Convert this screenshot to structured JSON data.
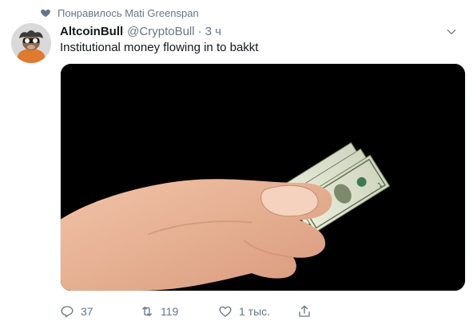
{
  "social_context": {
    "text": "Понравилось Mati Greenspan",
    "icon": "heart-icon"
  },
  "author": {
    "display_name": "AltcoinBull",
    "handle": "@CryptoBull",
    "separator": "·",
    "time": "3 ч"
  },
  "tweet": {
    "text": "Institutional money flowing in to bakkt"
  },
  "media": {
    "alt": "hand holding tiny dollar bills",
    "banknote_value": "1"
  },
  "actions": {
    "reply": {
      "icon": "reply-icon",
      "count": "37"
    },
    "retweet": {
      "icon": "retweet-icon",
      "count": "119"
    },
    "like": {
      "icon": "heart-outline-icon",
      "count": "1 тыс."
    },
    "share": {
      "icon": "share-icon"
    }
  },
  "colors": {
    "secondary_text": "#657786",
    "primary_text": "#14171a",
    "media_bg": "#000000"
  }
}
